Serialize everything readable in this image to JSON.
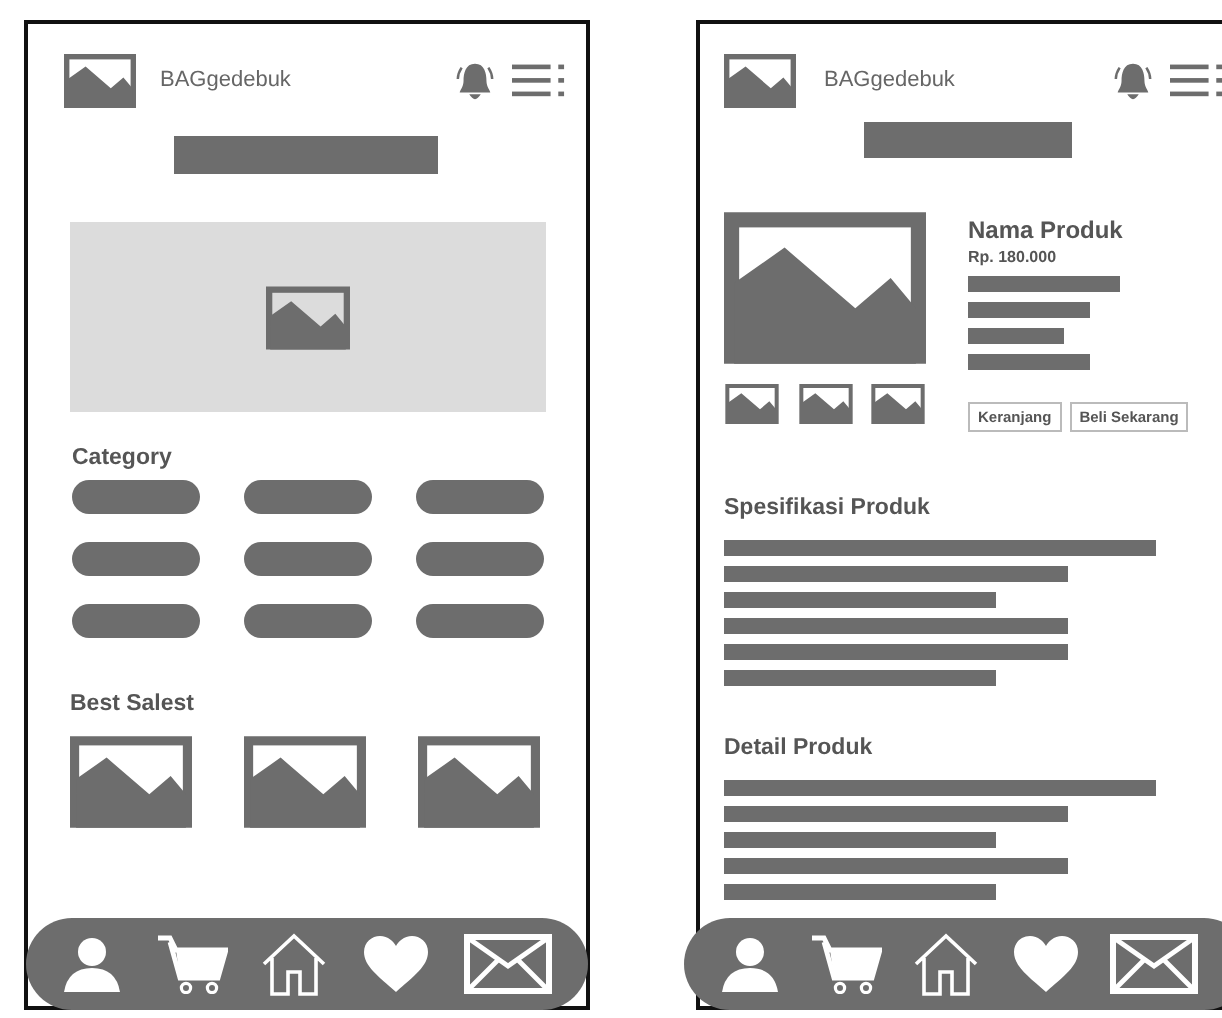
{
  "screens": [
    {
      "kind": "home",
      "header": {
        "brand": "BAGgedebuk"
      },
      "category": {
        "title": "Category"
      },
      "best_sellers": {
        "title": "Best Salest"
      },
      "nav": [
        {
          "kind": "user"
        },
        {
          "kind": "cart"
        },
        {
          "kind": "home"
        },
        {
          "kind": "heart"
        },
        {
          "kind": "mail"
        }
      ]
    },
    {
      "kind": "product",
      "header": {
        "brand": "BAGgedebuk"
      },
      "product": {
        "name": "Nama Produk",
        "price": "Rp. 180.000",
        "buttons": [
          "Keranjang",
          "Beli Sekarang"
        ]
      },
      "specs": {
        "title": "Spesifikasi Produk",
        "lines": [
          {
            "kind": "long"
          },
          {
            "kind": "medium"
          },
          {
            "kind": "short"
          },
          {
            "kind": "medium"
          },
          {
            "kind": "medium"
          },
          {
            "kind": "short"
          }
        ]
      },
      "details": {
        "title": "Detail Produk",
        "lines": [
          {
            "kind": "long"
          },
          {
            "kind": "medium"
          },
          {
            "kind": "short"
          },
          {
            "kind": "medium"
          },
          {
            "kind": "short"
          }
        ]
      },
      "nav": [
        {
          "kind": "user"
        },
        {
          "kind": "cart"
        },
        {
          "kind": "home"
        },
        {
          "kind": "heart"
        },
        {
          "kind": "mail"
        }
      ]
    }
  ]
}
